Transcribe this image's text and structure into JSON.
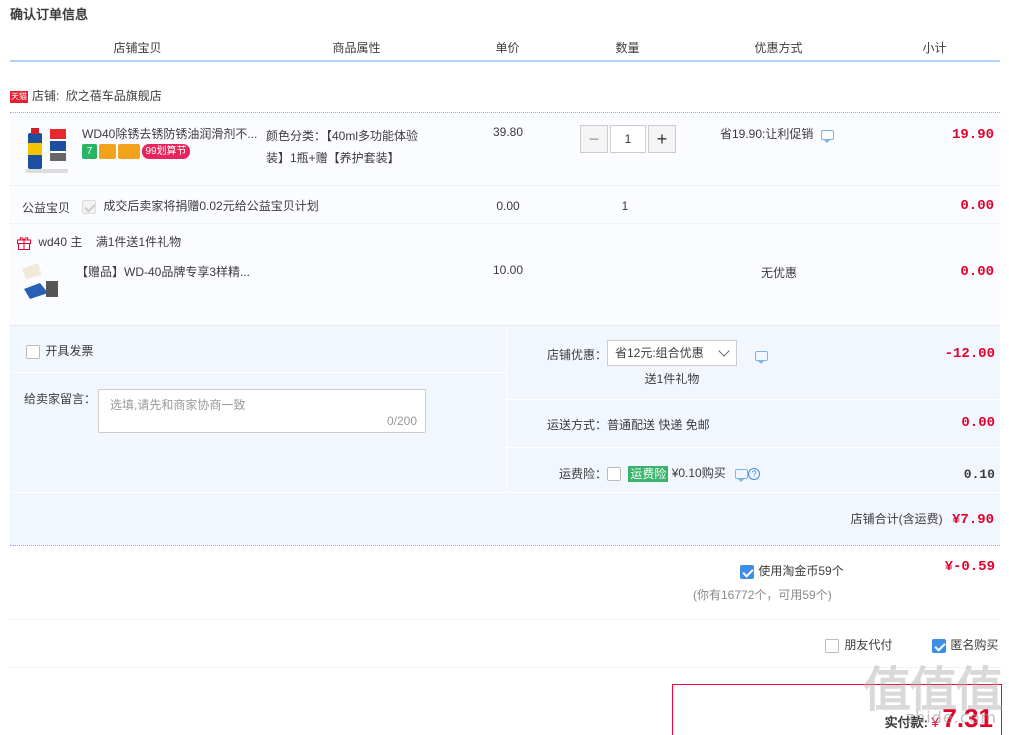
{
  "page_title": "确认订单信息",
  "columns": [
    "店铺宝贝",
    "商品属性",
    "单价",
    "数量",
    "优惠方式",
    "小计"
  ],
  "shop": {
    "badge": "天猫",
    "label": "店铺:",
    "name": "欣之蓓车品旗舰店"
  },
  "product": {
    "name": "WD40除锈去锈防锈油润滑剂不...",
    "attr": "颜色分类：【40ml多功能体验装】1瓶+赠【养护套装】",
    "price": "39.80",
    "qty": "1",
    "qty_minus": "−",
    "qty_plus": "+",
    "discount": "省19.90:让利促销",
    "subtotal": "19.90",
    "badges": [
      "7",
      "",
      "",
      "99划算节"
    ]
  },
  "charity": {
    "label": "公益宝贝",
    "text": "成交后卖家将捐赠0.02元给公益宝贝计划",
    "price": "0.00",
    "qty": "1",
    "subtotal": "0.00"
  },
  "gift_header": {
    "name": "wd40 主",
    "rule": "满1件送1件礼物"
  },
  "gift": {
    "name": "【赠品】WD-40品牌专享3样精...",
    "price": "10.00",
    "discount": "无优惠",
    "subtotal": "0.00"
  },
  "invoice": {
    "label": "开具发票"
  },
  "message": {
    "label": "给卖家留言：",
    "placeholder": "选填,请先和商家协商一致",
    "counter": "0/200"
  },
  "shop_discount": {
    "label": "店铺优惠：",
    "selected": "省12元:组合优惠",
    "gift_note": "送1件礼物",
    "amount": "-12.00"
  },
  "shipping": {
    "label": "运送方式：",
    "value": "普通配送 快递 免邮",
    "amount": "0.00"
  },
  "insurance": {
    "label": "运费险：",
    "tag": "运费险",
    "price_text": "¥0.10购买",
    "amount": "0.10"
  },
  "shop_total": {
    "label": "店铺合计(含运费)",
    "amount": "¥7.90"
  },
  "coins": {
    "label": "使用淘金币59个",
    "amount": "¥-0.59",
    "note": "(你有16772个，可用59个)"
  },
  "options": {
    "friend_pay": "朋友代付",
    "anonymous": "匿名购买"
  },
  "payment": {
    "label": "实付款:",
    "currency": "¥",
    "amount": "7.31"
  },
  "watermark": {
    "main": "值值值",
    "sub": "zhide.com"
  },
  "colors": {
    "accent_red": "#e4002b",
    "blue_border": "#b2d1ff",
    "panel_bg": "#f2f7ff"
  }
}
